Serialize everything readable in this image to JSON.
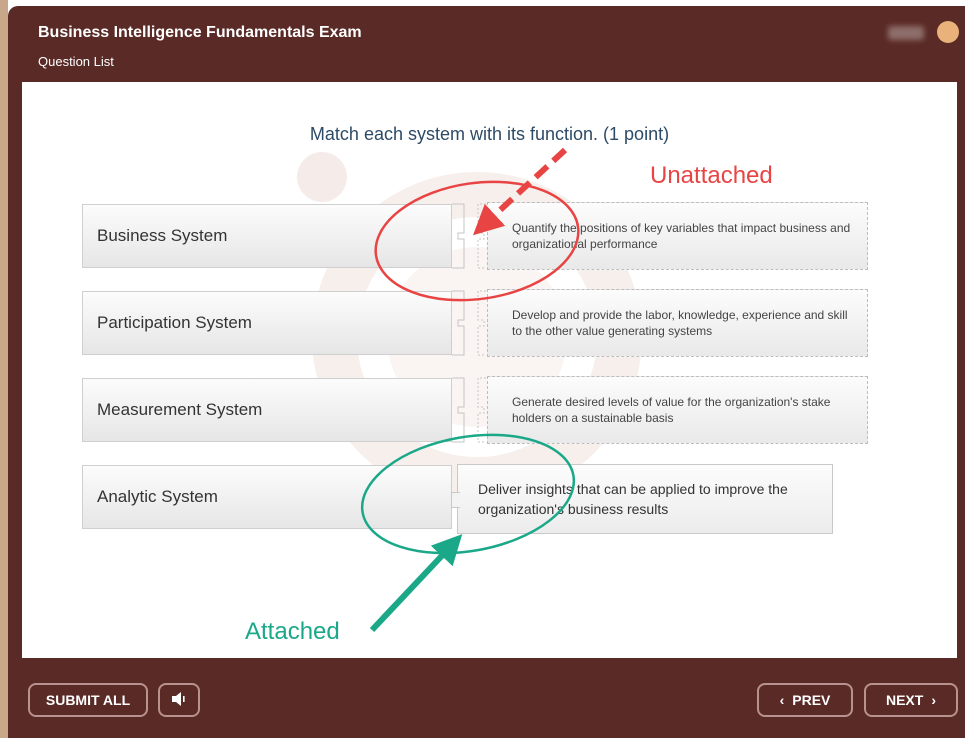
{
  "header": {
    "title": "Business Intelligence Fundamentals Exam",
    "subtitle": "Question List"
  },
  "question": "Match each system with its function.  (1 point)",
  "systems": [
    {
      "label": "Business System"
    },
    {
      "label": "Participation System"
    },
    {
      "label": "Measurement System"
    },
    {
      "label": "Analytic System"
    }
  ],
  "functions": [
    {
      "text": "Quantify the positions of key variables that impact business and organizational performance"
    },
    {
      "text": "Develop and provide the labor, knowledge, experience and skill to the other value generating systems"
    },
    {
      "text": "Generate desired levels of value for the organization's stake holders on a sustainable basis"
    }
  ],
  "attached": {
    "text": "Deliver insights that can be applied to improve the organization's business results"
  },
  "annotations": {
    "unattached": "Unattached",
    "attached": "Attached"
  },
  "footer": {
    "submit": "SUBMIT ALL",
    "prev": "PREV",
    "next": "NEXT"
  },
  "colors": {
    "frame": "#5a2a26",
    "question_text": "#2d4a66",
    "unattached": "#e84444",
    "attached": "#1aa889"
  }
}
